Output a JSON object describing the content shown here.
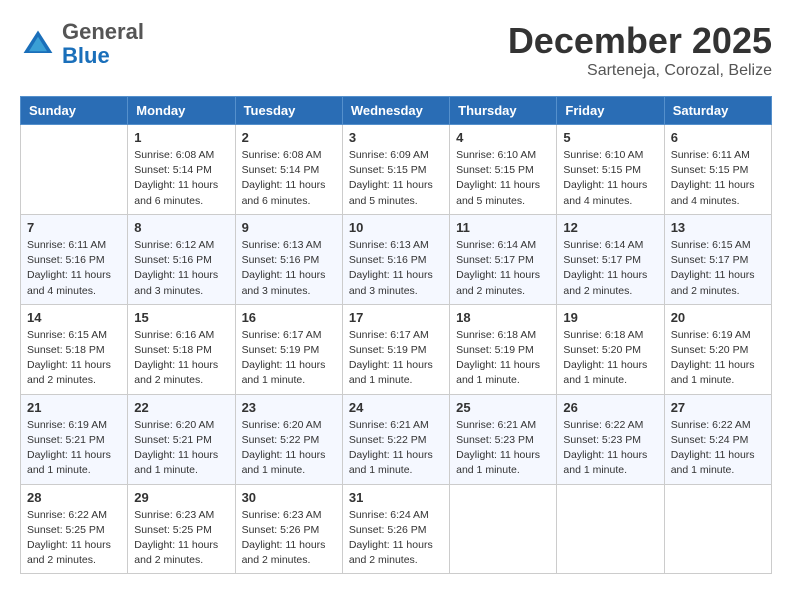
{
  "header": {
    "logo_general": "General",
    "logo_blue": "Blue",
    "month": "December 2025",
    "location": "Sarteneja, Corozal, Belize"
  },
  "days_of_week": [
    "Sunday",
    "Monday",
    "Tuesday",
    "Wednesday",
    "Thursday",
    "Friday",
    "Saturday"
  ],
  "weeks": [
    [
      {
        "day": "",
        "info": ""
      },
      {
        "day": "1",
        "info": "Sunrise: 6:08 AM\nSunset: 5:14 PM\nDaylight: 11 hours and 6 minutes."
      },
      {
        "day": "2",
        "info": "Sunrise: 6:08 AM\nSunset: 5:14 PM\nDaylight: 11 hours and 6 minutes."
      },
      {
        "day": "3",
        "info": "Sunrise: 6:09 AM\nSunset: 5:15 PM\nDaylight: 11 hours and 5 minutes."
      },
      {
        "day": "4",
        "info": "Sunrise: 6:10 AM\nSunset: 5:15 PM\nDaylight: 11 hours and 5 minutes."
      },
      {
        "day": "5",
        "info": "Sunrise: 6:10 AM\nSunset: 5:15 PM\nDaylight: 11 hours and 4 minutes."
      },
      {
        "day": "6",
        "info": "Sunrise: 6:11 AM\nSunset: 5:15 PM\nDaylight: 11 hours and 4 minutes."
      }
    ],
    [
      {
        "day": "7",
        "info": "Sunrise: 6:11 AM\nSunset: 5:16 PM\nDaylight: 11 hours and 4 minutes."
      },
      {
        "day": "8",
        "info": "Sunrise: 6:12 AM\nSunset: 5:16 PM\nDaylight: 11 hours and 3 minutes."
      },
      {
        "day": "9",
        "info": "Sunrise: 6:13 AM\nSunset: 5:16 PM\nDaylight: 11 hours and 3 minutes."
      },
      {
        "day": "10",
        "info": "Sunrise: 6:13 AM\nSunset: 5:16 PM\nDaylight: 11 hours and 3 minutes."
      },
      {
        "day": "11",
        "info": "Sunrise: 6:14 AM\nSunset: 5:17 PM\nDaylight: 11 hours and 2 minutes."
      },
      {
        "day": "12",
        "info": "Sunrise: 6:14 AM\nSunset: 5:17 PM\nDaylight: 11 hours and 2 minutes."
      },
      {
        "day": "13",
        "info": "Sunrise: 6:15 AM\nSunset: 5:17 PM\nDaylight: 11 hours and 2 minutes."
      }
    ],
    [
      {
        "day": "14",
        "info": "Sunrise: 6:15 AM\nSunset: 5:18 PM\nDaylight: 11 hours and 2 minutes."
      },
      {
        "day": "15",
        "info": "Sunrise: 6:16 AM\nSunset: 5:18 PM\nDaylight: 11 hours and 2 minutes."
      },
      {
        "day": "16",
        "info": "Sunrise: 6:17 AM\nSunset: 5:19 PM\nDaylight: 11 hours and 1 minute."
      },
      {
        "day": "17",
        "info": "Sunrise: 6:17 AM\nSunset: 5:19 PM\nDaylight: 11 hours and 1 minute."
      },
      {
        "day": "18",
        "info": "Sunrise: 6:18 AM\nSunset: 5:19 PM\nDaylight: 11 hours and 1 minute."
      },
      {
        "day": "19",
        "info": "Sunrise: 6:18 AM\nSunset: 5:20 PM\nDaylight: 11 hours and 1 minute."
      },
      {
        "day": "20",
        "info": "Sunrise: 6:19 AM\nSunset: 5:20 PM\nDaylight: 11 hours and 1 minute."
      }
    ],
    [
      {
        "day": "21",
        "info": "Sunrise: 6:19 AM\nSunset: 5:21 PM\nDaylight: 11 hours and 1 minute."
      },
      {
        "day": "22",
        "info": "Sunrise: 6:20 AM\nSunset: 5:21 PM\nDaylight: 11 hours and 1 minute."
      },
      {
        "day": "23",
        "info": "Sunrise: 6:20 AM\nSunset: 5:22 PM\nDaylight: 11 hours and 1 minute."
      },
      {
        "day": "24",
        "info": "Sunrise: 6:21 AM\nSunset: 5:22 PM\nDaylight: 11 hours and 1 minute."
      },
      {
        "day": "25",
        "info": "Sunrise: 6:21 AM\nSunset: 5:23 PM\nDaylight: 11 hours and 1 minute."
      },
      {
        "day": "26",
        "info": "Sunrise: 6:22 AM\nSunset: 5:23 PM\nDaylight: 11 hours and 1 minute."
      },
      {
        "day": "27",
        "info": "Sunrise: 6:22 AM\nSunset: 5:24 PM\nDaylight: 11 hours and 1 minute."
      }
    ],
    [
      {
        "day": "28",
        "info": "Sunrise: 6:22 AM\nSunset: 5:25 PM\nDaylight: 11 hours and 2 minutes."
      },
      {
        "day": "29",
        "info": "Sunrise: 6:23 AM\nSunset: 5:25 PM\nDaylight: 11 hours and 2 minutes."
      },
      {
        "day": "30",
        "info": "Sunrise: 6:23 AM\nSunset: 5:26 PM\nDaylight: 11 hours and 2 minutes."
      },
      {
        "day": "31",
        "info": "Sunrise: 6:24 AM\nSunset: 5:26 PM\nDaylight: 11 hours and 2 minutes."
      },
      {
        "day": "",
        "info": ""
      },
      {
        "day": "",
        "info": ""
      },
      {
        "day": "",
        "info": ""
      }
    ]
  ]
}
